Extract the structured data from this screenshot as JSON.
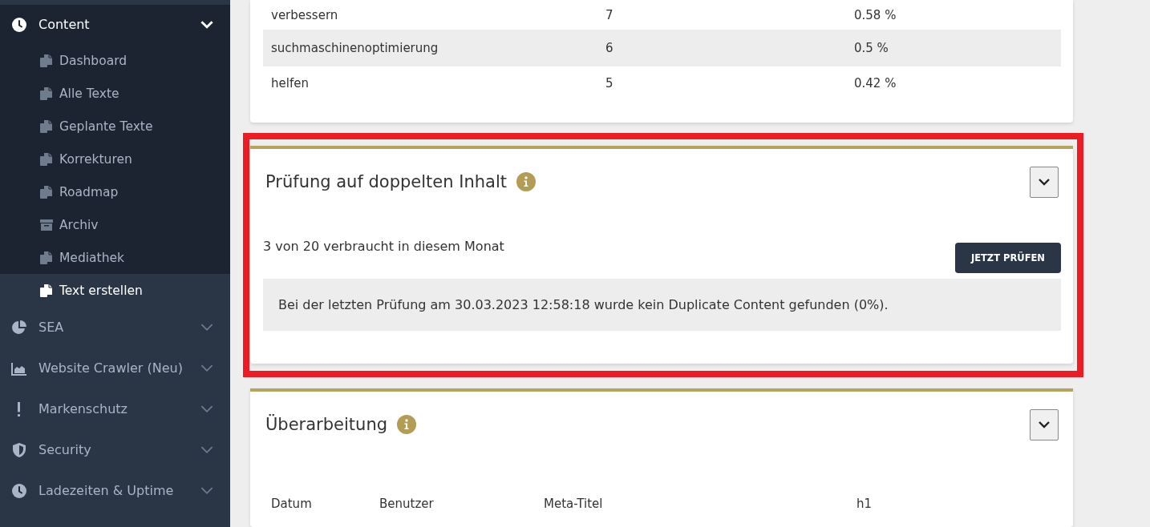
{
  "sidebar": {
    "groups": [
      {
        "label": "Content",
        "kind": "clock",
        "expanded": true,
        "items": [
          {
            "label": "Dashboard",
            "kind": "copy",
            "selected": false
          },
          {
            "label": "Alle Texte",
            "kind": "copy",
            "selected": false
          },
          {
            "label": "Geplante Texte",
            "kind": "copy",
            "selected": false
          },
          {
            "label": "Korrekturen",
            "kind": "copy",
            "selected": false
          },
          {
            "label": "Roadmap",
            "kind": "copy",
            "selected": false
          },
          {
            "label": "Archiv",
            "kind": "archive",
            "selected": false
          },
          {
            "label": "Mediathek",
            "kind": "copy",
            "selected": false
          },
          {
            "label": "Text erstellen",
            "kind": "copy",
            "selected": true
          }
        ]
      },
      {
        "label": "SEA",
        "kind": "pie",
        "expanded": false
      },
      {
        "label": "Website Crawler (Neu)",
        "kind": "area",
        "expanded": false
      },
      {
        "label": "Markenschutz",
        "kind": "exclamation",
        "expanded": false
      },
      {
        "label": "Security",
        "kind": "shield",
        "expanded": false
      },
      {
        "label": "Ladezeiten & Uptime",
        "kind": "clock",
        "expanded": false
      }
    ]
  },
  "keyword_table": {
    "rows": [
      [
        "verbessern",
        "7",
        "0.58 %"
      ],
      [
        "suchmaschinenoptimierung",
        "6",
        "0.5 %"
      ],
      [
        "helfen",
        "5",
        "0.42 %"
      ]
    ]
  },
  "duplicate_check": {
    "title": "Prüfung auf doppelten Inhalt",
    "usage": "3 von 20 verbraucht in diesem Monat",
    "button": "JETZT PRÜFEN",
    "result": "Bei der letzten Prüfung am 30.03.2023 12:58:18 wurde kein Duplicate Content gefunden (0%)."
  },
  "revision": {
    "title": "Überarbeitung",
    "columns": [
      "Datum",
      "Benutzer",
      "Meta-Titel",
      "h1"
    ]
  }
}
